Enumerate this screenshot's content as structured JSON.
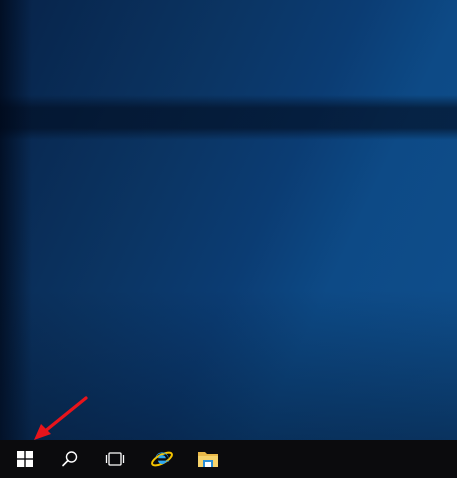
{
  "desktop": {
    "background": "windows-10-hero-blue",
    "accent": "#0d4a86"
  },
  "taskbar": {
    "background": "#0b0b0d",
    "items": [
      {
        "name": "start-button",
        "icon": "windows-logo-icon"
      },
      {
        "name": "search-button",
        "icon": "search-icon"
      },
      {
        "name": "task-view-button",
        "icon": "task-view-icon"
      },
      {
        "name": "internet-explorer-button",
        "icon": "internet-explorer-icon"
      },
      {
        "name": "file-explorer-button",
        "icon": "file-explorer-icon"
      }
    ]
  },
  "annotation": {
    "icon": "red-arrow-icon",
    "color": "#e8141b",
    "points_to": "start-button"
  }
}
